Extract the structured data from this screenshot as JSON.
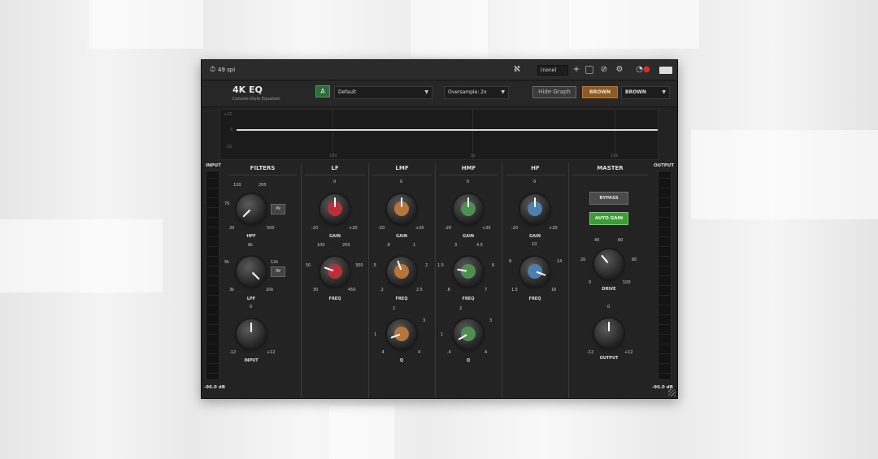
{
  "topbar": {
    "spi": "49 spi",
    "preset": "(none)"
  },
  "header": {
    "title": "4K EQ",
    "subtitle": "Console-Style Equalizer",
    "ab_label": "A",
    "preset_label": "Default",
    "oversample_label": "Oversample: 2x",
    "hide_graph_label": "Hide Graph",
    "brown_button_label": "BROWN",
    "brown_dropdown_label": "BROWN"
  },
  "graph": {
    "y_ticks": [
      "+20",
      "0",
      "-20"
    ],
    "x_ticks": [
      "100",
      "1k",
      "10k"
    ]
  },
  "meters": {
    "input_label": "INPUT",
    "output_label": "OUTPUT",
    "input_db": "-96.0 dB",
    "output_db": "-96.0 dB"
  },
  "sections": {
    "filters": "FILTERS",
    "lf": "LF",
    "lmf": "LMF",
    "hmf": "HMF",
    "hf": "HF",
    "master": "MASTER"
  },
  "knobs": {
    "hpf": {
      "label": "HPF",
      "s1": "120",
      "s2": "200",
      "s3": "70",
      "s4": "20",
      "s5": "500"
    },
    "lpf": {
      "label": "LPF",
      "s1": "8k",
      "s2": "5k",
      "s3": "12k",
      "s4": "3k",
      "s5": "20k"
    },
    "input": {
      "label": "INPUT",
      "s1": "0",
      "s2": "-12",
      "s3": "+12"
    },
    "lf_gain": {
      "label": "GAIN",
      "s1": "0",
      "s2": "-20",
      "s3": "+20"
    },
    "lf_freq": {
      "label": "FREQ",
      "s1": "100",
      "s2": "200",
      "s3": "50",
      "s4": "300",
      "s5": "30",
      "s6": "450"
    },
    "lmf_gain": {
      "label": "GAIN",
      "s1": "0",
      "s2": "-20",
      "s3": "+20"
    },
    "lmf_freq": {
      "label": "FREQ",
      "s1": ".8",
      "s2": "1",
      "s3": ".5",
      "s4": "2",
      "s5": ".2",
      "s6": "2.5"
    },
    "lmf_q": {
      "label": "Q",
      "s1": "2",
      "s2": "1",
      "s3": "3",
      "s4": ".4",
      "s5": "4"
    },
    "hmf_gain": {
      "label": "GAIN",
      "s1": "0",
      "s2": "-20",
      "s3": "+20"
    },
    "hmf_freq": {
      "label": "FREQ",
      "s1": "3",
      "s2": "4.5",
      "s3": "1.5",
      "s4": "6",
      "s5": ".6",
      "s6": "7"
    },
    "hmf_q": {
      "label": "Q",
      "s1": "2",
      "s2": "1",
      "s3": "3",
      "s4": ".4",
      "s5": "4"
    },
    "hf_gain": {
      "label": "GAIN",
      "s1": "0",
      "s2": "-20",
      "s3": "+20"
    },
    "hf_freq": {
      "label": "FREQ",
      "s1": "10",
      "s2": "8",
      "s3": "14",
      "s4": "1.5",
      "s5": "16"
    },
    "drive": {
      "label": "DRIVE",
      "s1": "40",
      "s2": "60",
      "s3": "20",
      "s4": "80",
      "s5": "0",
      "s6": "100"
    },
    "output": {
      "label": "OUTPUT",
      "s1": "0",
      "s2": "-12",
      "s3": "+12"
    }
  },
  "buttons": {
    "hpf_in": "IN",
    "lpf_in": "IN",
    "bypass": "BYPASS",
    "auto_gain": "AUTO GAIN"
  },
  "colors": {
    "lf": "#b8303a",
    "lmf": "#b8743a",
    "hmf": "#4e8f50",
    "hf": "#4d7fae",
    "auto_gain": "#3f9a3a",
    "brown": "#8b5a25"
  }
}
